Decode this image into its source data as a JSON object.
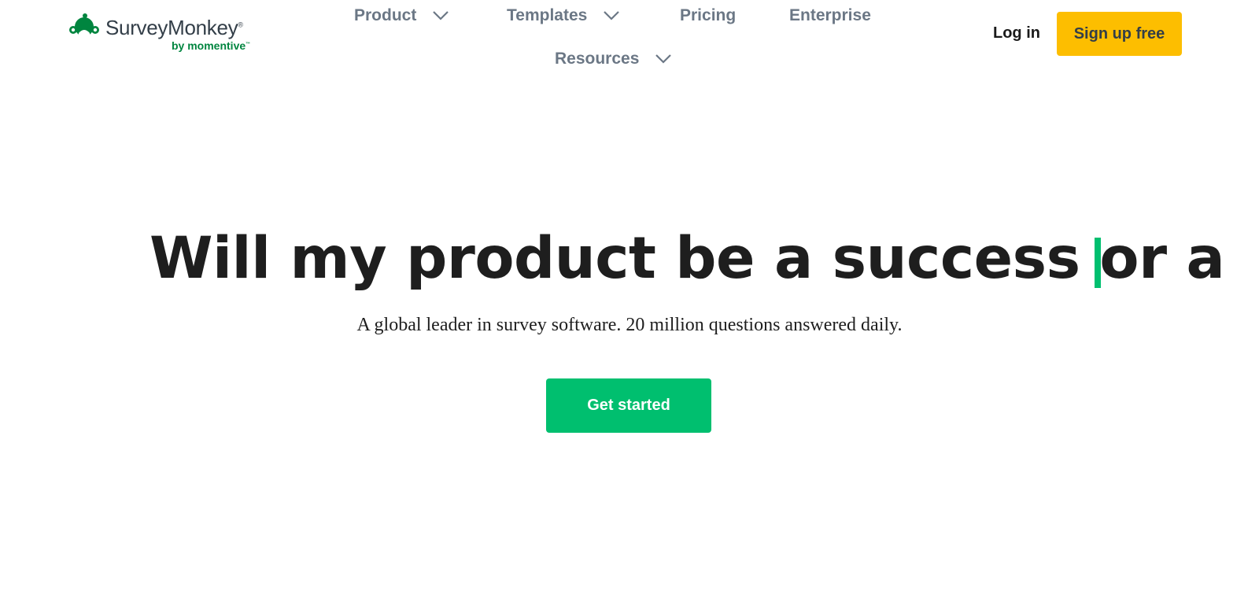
{
  "logo": {
    "brand": "SurveyMonkey",
    "registered_mark": "®",
    "byline": "by momentive",
    "trademark": "™",
    "icon": "monkey-logo-icon",
    "color": "#00853f"
  },
  "nav": {
    "product": "Product",
    "templates": "Templates",
    "pricing": "Pricing",
    "enterprise": "Enterprise",
    "resources": "Resources",
    "dropdown_icon": "chevron-down-icon",
    "color": "#6b7785"
  },
  "auth": {
    "login": "Log in",
    "signup": "Sign up free",
    "signup_color": "#fdbe00"
  },
  "hero": {
    "headline": "Will my product be a success or a",
    "caret_color": "#00bf6f",
    "subheadline": "A global leader in survey software. 20 million questions answered daily.",
    "cta": "Get started",
    "cta_color": "#00bf6f"
  }
}
